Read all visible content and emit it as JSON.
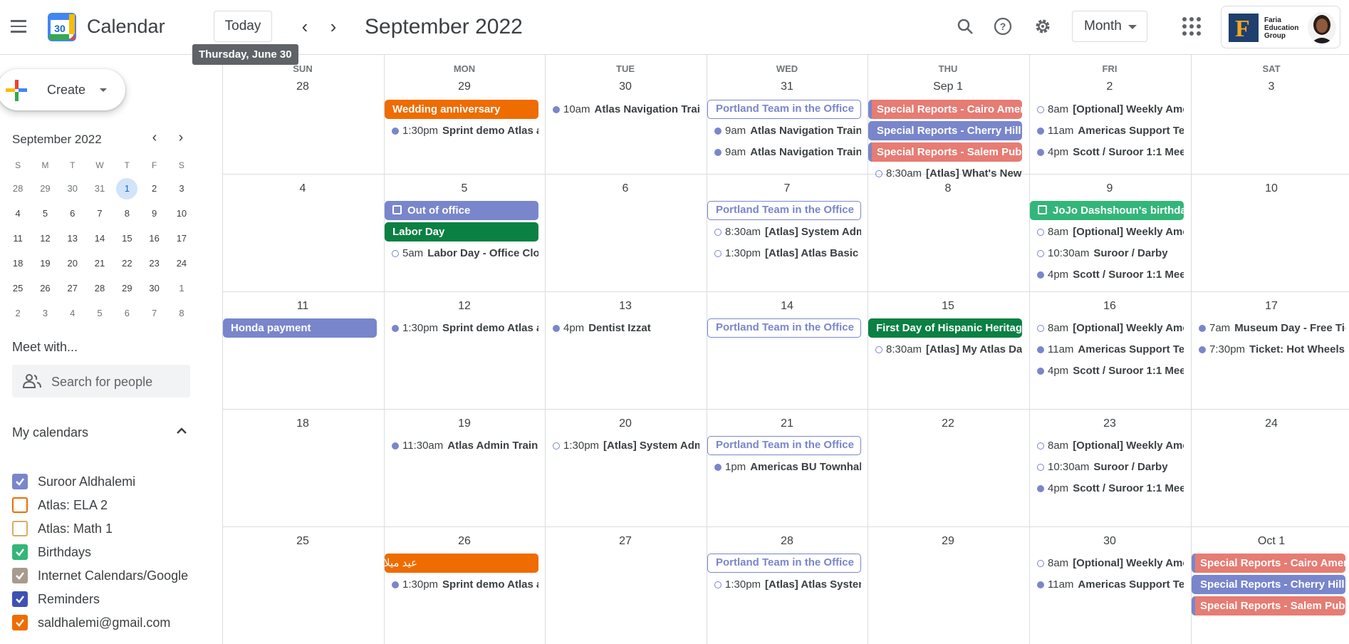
{
  "app": {
    "title": "Calendar",
    "logo_day": "30",
    "today_label": "Today",
    "tooltip": "Thursday, June 30",
    "month_title": "September 2022",
    "view_label": "Month",
    "org_name": [
      "Faria",
      "Education",
      "Group"
    ]
  },
  "sidebar": {
    "create_label": "Create",
    "mini": {
      "title": "September 2022",
      "weekdays": [
        "S",
        "M",
        "T",
        "W",
        "T",
        "F",
        "S"
      ],
      "days": [
        "28",
        "29",
        "30",
        "31",
        "1",
        "2",
        "3",
        "4",
        "5",
        "6",
        "7",
        "8",
        "9",
        "10",
        "11",
        "12",
        "13",
        "14",
        "15",
        "16",
        "17",
        "18",
        "19",
        "20",
        "21",
        "22",
        "23",
        "24",
        "25",
        "26",
        "27",
        "28",
        "29",
        "30",
        "1",
        "2",
        "3",
        "4",
        "5",
        "6",
        "7",
        "8"
      ],
      "today_index": 4
    },
    "meet_title": "Meet with...",
    "people_placeholder": "Search for people",
    "my_calendars_title": "My calendars",
    "calendars": [
      {
        "label": "Suroor Aldhalemi",
        "color": "#7986cb",
        "checked": true
      },
      {
        "label": "Atlas: ELA 2",
        "color": "#ef6c00",
        "checked": false
      },
      {
        "label": "Atlas: Math 1",
        "color": "#d6ae62",
        "checked": false
      },
      {
        "label": "Birthdays",
        "color": "#33b679",
        "checked": true
      },
      {
        "label": "Internet Calendars/Google",
        "color": "#a79b8e",
        "checked": true
      },
      {
        "label": "Reminders",
        "color": "#3f51b5",
        "checked": true
      },
      {
        "label": "saldhalemi@gmail.com",
        "color": "#ef6c00",
        "checked": true
      }
    ]
  },
  "month": {
    "weekdays": [
      "SUN",
      "MON",
      "TUE",
      "WED",
      "THU",
      "FRI",
      "SAT"
    ],
    "weeks": [
      [
        "28",
        "29",
        "30",
        "31",
        "Sep 1",
        "2",
        "3"
      ],
      [
        "4",
        "5",
        "6",
        "7",
        "8",
        "9",
        "10"
      ],
      [
        "11",
        "12",
        "13",
        "14",
        "15",
        "16",
        "17"
      ],
      [
        "18",
        "19",
        "20",
        "21",
        "22",
        "23",
        "24"
      ],
      [
        "25",
        "26",
        "27",
        "28",
        "29",
        "30",
        "Oct 1"
      ]
    ],
    "events": [
      {
        "week": 0,
        "day": 1,
        "slot": 0,
        "kind": "chip",
        "color": "#ef6c00",
        "title": "Wedding anniversary"
      },
      {
        "week": 0,
        "day": 1,
        "slot": 1,
        "kind": "dot",
        "time": "1:30pm",
        "title": "Sprint demo Atlas a"
      },
      {
        "week": 0,
        "day": 2,
        "slot": 0,
        "kind": "dot",
        "time": "10am",
        "title": "Atlas Navigation Trair"
      },
      {
        "week": 0,
        "day": 3,
        "slot": 0,
        "kind": "outline",
        "title": "Portland Team in the Office"
      },
      {
        "week": 0,
        "day": 3,
        "slot": 1,
        "kind": "dot",
        "time": "9am",
        "title": "Atlas Navigation Traini"
      },
      {
        "week": 0,
        "day": 3,
        "slot": 2,
        "kind": "dot",
        "time": "9am",
        "title": "Atlas Navigation Traini"
      },
      {
        "week": 0,
        "day": 4,
        "slot": 0,
        "kind": "stripe",
        "color": "#e67c73",
        "title": "Special Reports - Cairo Ameri"
      },
      {
        "week": 0,
        "day": 4,
        "slot": 1,
        "kind": "stripe",
        "color": "#7986cb",
        "title": "Special Reports - Cherry Hill I"
      },
      {
        "week": 0,
        "day": 4,
        "slot": 2,
        "kind": "stripe",
        "color": "#e67c73",
        "title": "Special Reports - Salem Publ"
      },
      {
        "week": 0,
        "day": 4,
        "slot": 3,
        "kind": "ring",
        "time": "8:30am",
        "title": "[Atlas] What's New i"
      },
      {
        "week": 0,
        "day": 5,
        "slot": 0,
        "kind": "ring",
        "time": "8am",
        "title": "[Optional] Weekly Amer"
      },
      {
        "week": 0,
        "day": 5,
        "slot": 1,
        "kind": "dot",
        "time": "11am",
        "title": "Americas Support Tea"
      },
      {
        "week": 0,
        "day": 5,
        "slot": 2,
        "kind": "dot",
        "time": "4pm",
        "title": "Scott / Suroor 1:1 Mee"
      },
      {
        "week": 1,
        "day": 1,
        "slot": 0,
        "kind": "chip",
        "color": "#7986cb",
        "icon": true,
        "title": "Out of office"
      },
      {
        "week": 1,
        "day": 1,
        "slot": 1,
        "kind": "chip",
        "color": "#0b8043",
        "title": "Labor Day"
      },
      {
        "week": 1,
        "day": 1,
        "slot": 2,
        "kind": "ring",
        "time": "5am",
        "title": "Labor Day - Office Clos"
      },
      {
        "week": 1,
        "day": 3,
        "slot": 0,
        "kind": "outline",
        "title": "Portland Team in the Office"
      },
      {
        "week": 1,
        "day": 3,
        "slot": 1,
        "kind": "ring",
        "time": "8:30am",
        "title": "[Atlas] System Adm"
      },
      {
        "week": 1,
        "day": 3,
        "slot": 2,
        "kind": "ring",
        "time": "1:30pm",
        "title": "[Atlas] Atlas Basic N"
      },
      {
        "week": 1,
        "day": 5,
        "slot": 0,
        "kind": "chip",
        "color": "#33b679",
        "icon": true,
        "title": "JoJo Dashshoun's birthda"
      },
      {
        "week": 1,
        "day": 5,
        "slot": 1,
        "kind": "ring",
        "time": "8am",
        "title": "[Optional] Weekly Amer"
      },
      {
        "week": 1,
        "day": 5,
        "slot": 2,
        "kind": "ring",
        "time": "10:30am",
        "title": "Suroor / Darby"
      },
      {
        "week": 1,
        "day": 5,
        "slot": 3,
        "kind": "dot",
        "time": "4pm",
        "title": "Scott / Suroor 1:1 Mee"
      },
      {
        "week": 2,
        "day": 0,
        "slot": 0,
        "kind": "chip",
        "color": "#7986cb",
        "title": "Honda payment"
      },
      {
        "week": 2,
        "day": 1,
        "slot": 0,
        "kind": "dot",
        "time": "1:30pm",
        "title": "Sprint demo Atlas a"
      },
      {
        "week": 2,
        "day": 2,
        "slot": 0,
        "kind": "dot",
        "time": "4pm",
        "title": "Dentist Izzat"
      },
      {
        "week": 2,
        "day": 3,
        "slot": 0,
        "kind": "outline",
        "title": "Portland Team in the Office"
      },
      {
        "week": 2,
        "day": 4,
        "slot": 0,
        "kind": "chip",
        "color": "#0b8043",
        "title": "First Day of Hispanic Heritage"
      },
      {
        "week": 2,
        "day": 4,
        "slot": 1,
        "kind": "ring",
        "time": "8:30am",
        "title": "[Atlas] My Atlas Das"
      },
      {
        "week": 2,
        "day": 5,
        "slot": 0,
        "kind": "ring",
        "time": "8am",
        "title": "[Optional] Weekly Amer"
      },
      {
        "week": 2,
        "day": 5,
        "slot": 1,
        "kind": "dot",
        "time": "11am",
        "title": "Americas Support Tea"
      },
      {
        "week": 2,
        "day": 5,
        "slot": 2,
        "kind": "dot",
        "time": "4pm",
        "title": "Scott / Suroor 1:1 Mee"
      },
      {
        "week": 2,
        "day": 6,
        "slot": 0,
        "kind": "dot",
        "time": "7am",
        "title": "Museum Day - Free Tic"
      },
      {
        "week": 2,
        "day": 6,
        "slot": 1,
        "kind": "dot",
        "time": "7:30pm",
        "title": "Ticket: Hot Wheels I"
      },
      {
        "week": 3,
        "day": 1,
        "slot": 0,
        "kind": "dot",
        "time": "11:30am",
        "title": "Atlas Admin Traini"
      },
      {
        "week": 3,
        "day": 2,
        "slot": 0,
        "kind": "ring",
        "time": "1:30pm",
        "title": "[Atlas] System Adm"
      },
      {
        "week": 3,
        "day": 3,
        "slot": 0,
        "kind": "outline",
        "title": "Portland Team in the Office"
      },
      {
        "week": 3,
        "day": 3,
        "slot": 1,
        "kind": "dot",
        "time": "1pm",
        "title": "Americas BU Townhall"
      },
      {
        "week": 3,
        "day": 5,
        "slot": 0,
        "kind": "ring",
        "time": "8am",
        "title": "[Optional] Weekly Amer"
      },
      {
        "week": 3,
        "day": 5,
        "slot": 1,
        "kind": "ring",
        "time": "10:30am",
        "title": "Suroor / Darby"
      },
      {
        "week": 3,
        "day": 5,
        "slot": 2,
        "kind": "dot",
        "time": "4pm",
        "title": "Scott / Suroor 1:1 Mee"
      },
      {
        "week": 4,
        "day": 1,
        "slot": 0,
        "kind": "chip",
        "color": "#ef6c00",
        "rtl": true,
        "title": "عيد ميلاد روجر"
      },
      {
        "week": 4,
        "day": 1,
        "slot": 1,
        "kind": "dot",
        "time": "1:30pm",
        "title": "Sprint demo Atlas a"
      },
      {
        "week": 4,
        "day": 3,
        "slot": 0,
        "kind": "outline",
        "title": "Portland Team in the Office"
      },
      {
        "week": 4,
        "day": 3,
        "slot": 1,
        "kind": "ring",
        "time": "1:30pm",
        "title": "[Atlas] Atlas System"
      },
      {
        "week": 4,
        "day": 5,
        "slot": 0,
        "kind": "ring",
        "time": "8am",
        "title": "[Optional] Weekly Amer"
      },
      {
        "week": 4,
        "day": 5,
        "slot": 1,
        "kind": "dot",
        "time": "11am",
        "title": "Americas Support Tea"
      },
      {
        "week": 4,
        "day": 6,
        "slot": 0,
        "kind": "stripe",
        "color": "#e67c73",
        "title": "Special Reports - Cairo Ameri"
      },
      {
        "week": 4,
        "day": 6,
        "slot": 1,
        "kind": "stripe",
        "color": "#7986cb",
        "title": "Special Reports - Cherry Hill I"
      },
      {
        "week": 4,
        "day": 6,
        "slot": 2,
        "kind": "stripe",
        "color": "#e67c73",
        "title": "Special Reports - Salem Publ"
      }
    ]
  }
}
